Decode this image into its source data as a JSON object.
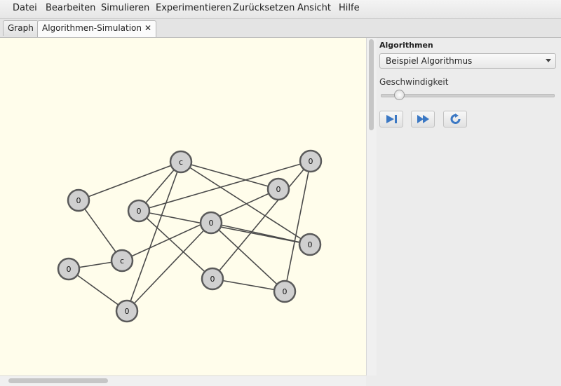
{
  "menu": [
    "Datei",
    "Bearbeiten",
    "Simulieren",
    "Experimentieren",
    "Zurücksetzen",
    "Ansicht",
    "Hilfe"
  ],
  "tabs": [
    {
      "label": "Graph",
      "active": false
    },
    {
      "label": "Algorithmen-Simulation",
      "active": true,
      "close": "✕"
    }
  ],
  "panel": {
    "title": "Algorithmen",
    "algorithm_selected": "Beispiel Algorithmus",
    "speed_label": "Geschwindigkeit",
    "speed_level": 0.1
  },
  "toolbar_icons": [
    "step-forward-icon",
    "fast-forward-icon",
    "reset-icon"
  ],
  "icon_color": "#3b78c4",
  "graph": {
    "nodes": [
      {
        "id": "A",
        "label": "c"
      },
      {
        "id": "B",
        "label": "0"
      },
      {
        "id": "C",
        "label": "0"
      },
      {
        "id": "D",
        "label": "0"
      },
      {
        "id": "E",
        "label": "0"
      },
      {
        "id": "F",
        "label": "0"
      },
      {
        "id": "G",
        "label": "0"
      },
      {
        "id": "H",
        "label": "c"
      },
      {
        "id": "I",
        "label": "0"
      },
      {
        "id": "J",
        "label": "0"
      },
      {
        "id": "K",
        "label": "0"
      },
      {
        "id": "L",
        "label": "0"
      }
    ],
    "edges": [
      [
        "A",
        "B"
      ],
      [
        "A",
        "C"
      ],
      [
        "A",
        "G"
      ],
      [
        "A",
        "F"
      ],
      [
        "A",
        "J"
      ],
      [
        "B",
        "H"
      ],
      [
        "E",
        "C"
      ],
      [
        "E",
        "K"
      ],
      [
        "E",
        "L"
      ],
      [
        "H",
        "F"
      ],
      [
        "H",
        "I"
      ],
      [
        "I",
        "J"
      ],
      [
        "D",
        "J"
      ],
      [
        "D",
        "G"
      ],
      [
        "C",
        "G"
      ],
      [
        "D",
        "L"
      ],
      [
        "L",
        "K"
      ],
      [
        "C",
        "K"
      ]
    ]
  }
}
